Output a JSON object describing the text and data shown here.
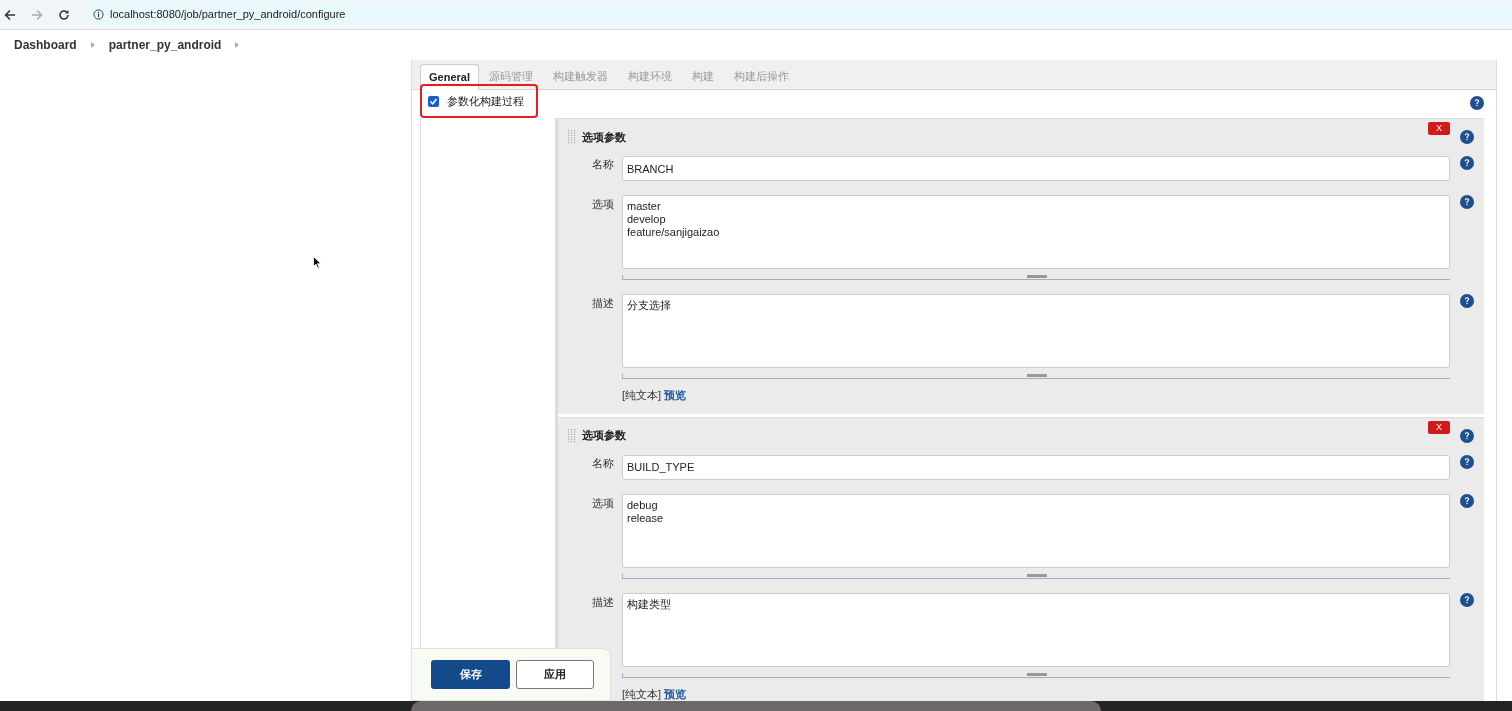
{
  "browser": {
    "url": "localhost:8080/job/partner_py_android/configure"
  },
  "breadcrumbs": [
    "Dashboard",
    "partner_py_android"
  ],
  "tabs": [
    {
      "label": "General",
      "selected": true
    },
    {
      "label": "源码管理",
      "selected": false
    },
    {
      "label": "构建触发器",
      "selected": false
    },
    {
      "label": "构建环境",
      "selected": false
    },
    {
      "label": "构建",
      "selected": false
    },
    {
      "label": "构建后操作",
      "selected": false
    }
  ],
  "parameterized": {
    "label": "参数化构建过程",
    "checked": true
  },
  "parameters": [
    {
      "title": "选项参数",
      "delete": "X",
      "fields": [
        {
          "label": "名称",
          "kind": "text",
          "value": "BRANCH"
        },
        {
          "label": "选项",
          "kind": "textarea",
          "value": "master\ndevelop\nfeature/sanjigaizao"
        },
        {
          "label": "描述",
          "kind": "textarea",
          "value": "分支选择"
        }
      ],
      "format": "[纯文本]",
      "preview": "预览"
    },
    {
      "title": "选项参数",
      "delete": "X",
      "fields": [
        {
          "label": "名称",
          "kind": "text",
          "value": "BUILD_TYPE"
        },
        {
          "label": "选项",
          "kind": "textarea",
          "value": "debug\nrelease"
        },
        {
          "label": "描述",
          "kind": "textarea",
          "value": "构建类型"
        }
      ],
      "format": "[纯文本]",
      "preview": "预览"
    }
  ],
  "buttons": [
    {
      "label": "保存",
      "primary": true
    },
    {
      "label": "应用",
      "primary": false
    }
  ]
}
